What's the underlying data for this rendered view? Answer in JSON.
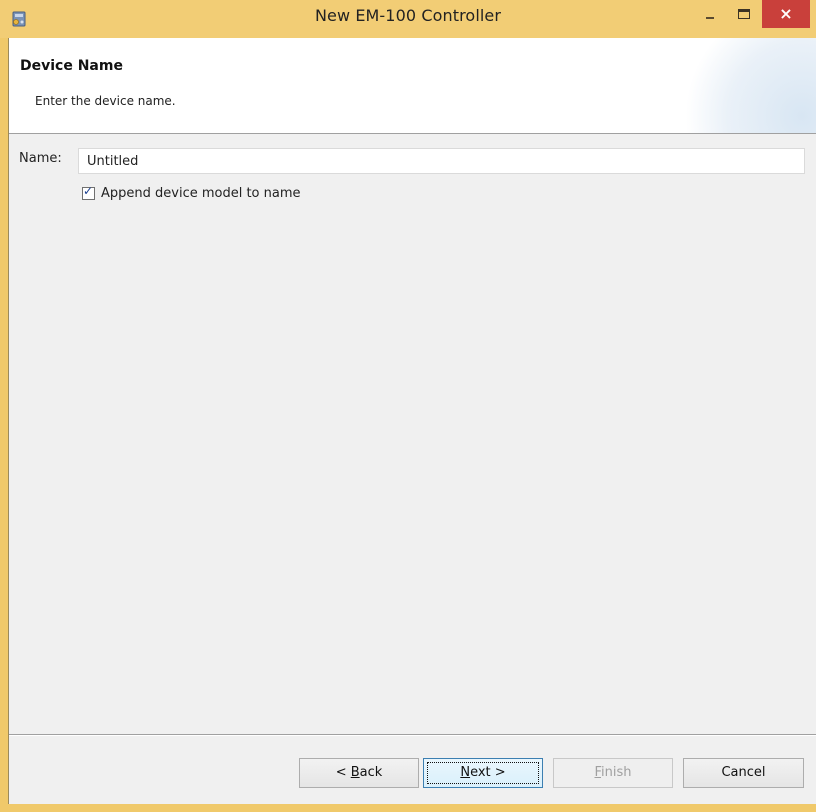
{
  "window": {
    "title": "New EM-100 Controller",
    "icon": "application-icon",
    "controls": {
      "minimize": "–",
      "maximize": "□",
      "close": "×"
    },
    "frame_color": "#f2cd75",
    "close_color": "#c9403b"
  },
  "header": {
    "title": "Device Name",
    "description": "Enter the device name."
  },
  "form": {
    "name_label": "Name:",
    "name_value": "Untitled",
    "append_checkbox": {
      "checked": true,
      "label": "Append device model to name"
    }
  },
  "buttons": {
    "back": {
      "prefix": "< ",
      "mnemonic": "B",
      "rest": "ack",
      "enabled": true
    },
    "next": {
      "prefix": "",
      "mnemonic": "N",
      "rest": "ext >",
      "enabled": true
    },
    "finish": {
      "prefix": "",
      "mnemonic": "F",
      "rest": "inish",
      "enabled": false
    },
    "cancel": {
      "label": "Cancel",
      "enabled": true
    }
  }
}
